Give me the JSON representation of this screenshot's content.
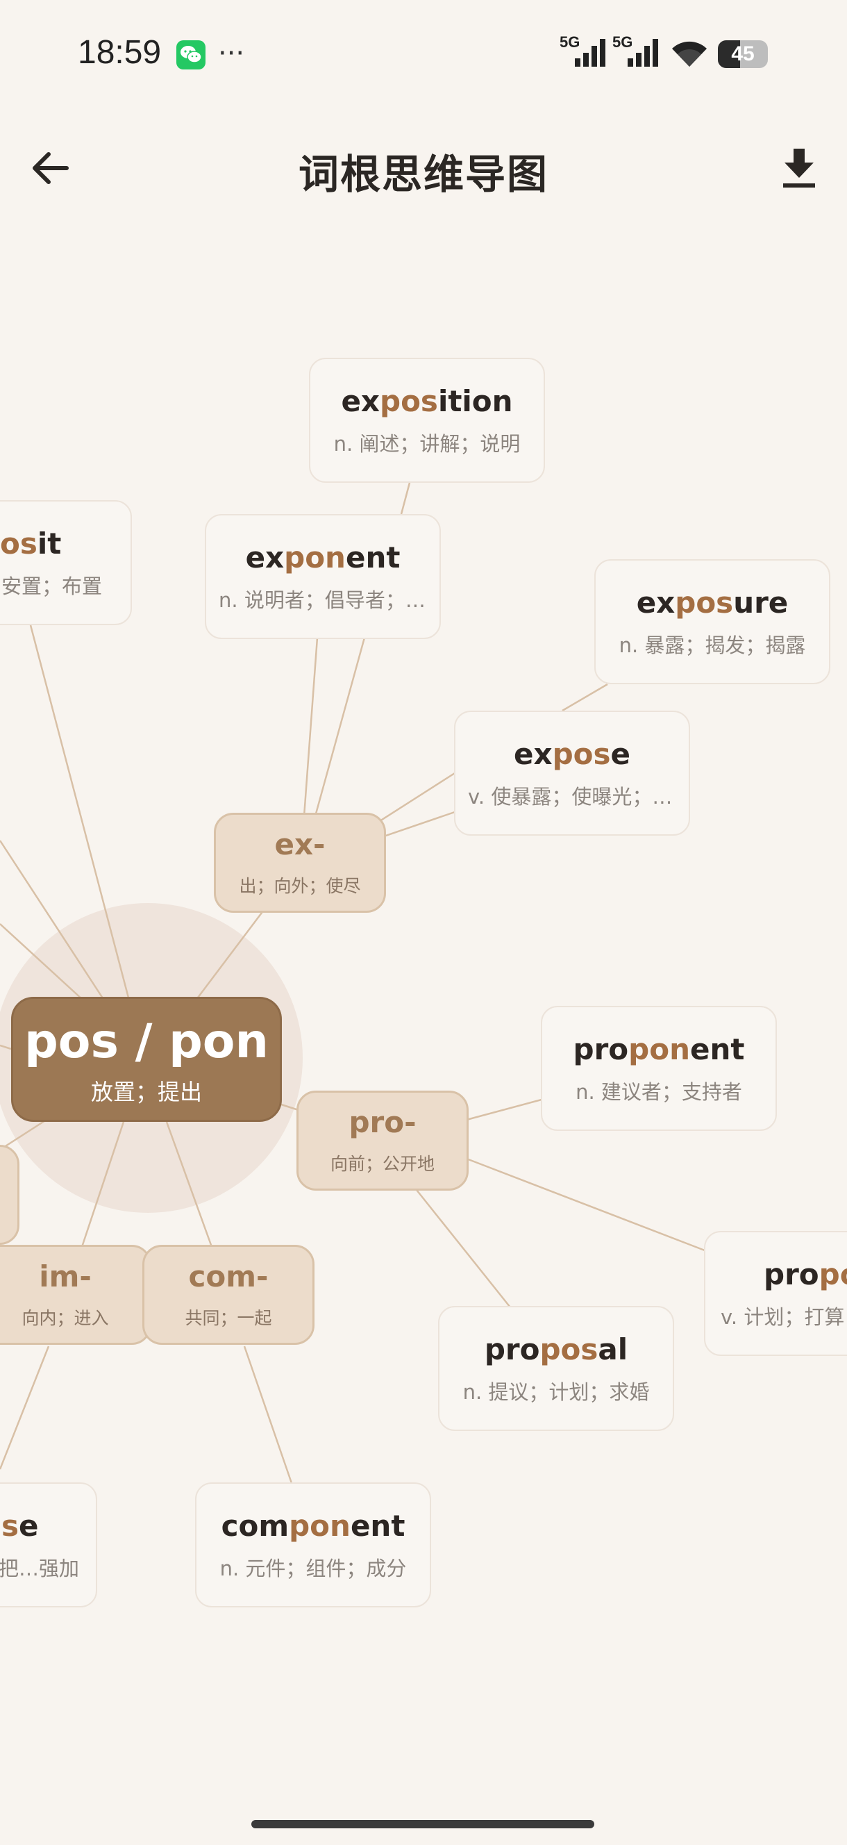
{
  "status_bar": {
    "time": "18:59",
    "signal_1": "5G",
    "signal_2": "5G",
    "battery": "45",
    "battery_level_percent": 45
  },
  "app_bar": {
    "title": "词根思维导图",
    "back_icon": "arrow-left-icon",
    "download_icon": "download-icon"
  },
  "root": {
    "label": "pos / pon",
    "meaning": "放置；提出"
  },
  "prefixes": {
    "ex": {
      "label": "ex-",
      "meaning": "出；向外；使尽"
    },
    "pro": {
      "label": "pro-",
      "meaning": "向前；公开地"
    },
    "im": {
      "label": "im-",
      "meaning": "向内；进入"
    },
    "com": {
      "label": "com-",
      "meaning": "共同；一起"
    }
  },
  "words": {
    "exposition": {
      "pre": "ex",
      "hl": "pos",
      "post": "ition",
      "def": "n. 阐述；讲解；说明"
    },
    "exponent": {
      "pre": "ex",
      "hl": "pon",
      "post": "ent",
      "def": "n. 说明者；倡导者；指数"
    },
    "exposure": {
      "pre": "ex",
      "hl": "pos",
      "post": "ure",
      "def": "n. 暴露；揭发；揭露"
    },
    "expose": {
      "pre": "ex",
      "hl": "pos",
      "post": "e",
      "def": "v. 使暴露；使曝光；揭露"
    },
    "deposit_partial": {
      "pre": "",
      "hl": "os",
      "post": "it",
      "def": "安置；布置"
    },
    "proponent": {
      "pre": "pro",
      "hl": "pon",
      "post": "ent",
      "def": "n. 建议者；支持者"
    },
    "propose_partial": {
      "pre": "pro",
      "hl": "po",
      "post": "",
      "def": "v. 计划；打算"
    },
    "proposal": {
      "pre": "pro",
      "hl": "pos",
      "post": "al",
      "def": "n. 提议；计划；求婚"
    },
    "component": {
      "pre": "com",
      "hl": "pon",
      "post": "ent",
      "def": "n. 元件；组件；成分"
    },
    "impose_partial": {
      "pre": "",
      "hl": "s",
      "post": "e",
      "def": "把…强加"
    }
  },
  "colors": {
    "background": "#f8f4ef",
    "root_fill": "#9c7854",
    "prefix_fill": "#ecdccb",
    "highlight": "#a46e42",
    "edge": "#d8c0a6"
  }
}
